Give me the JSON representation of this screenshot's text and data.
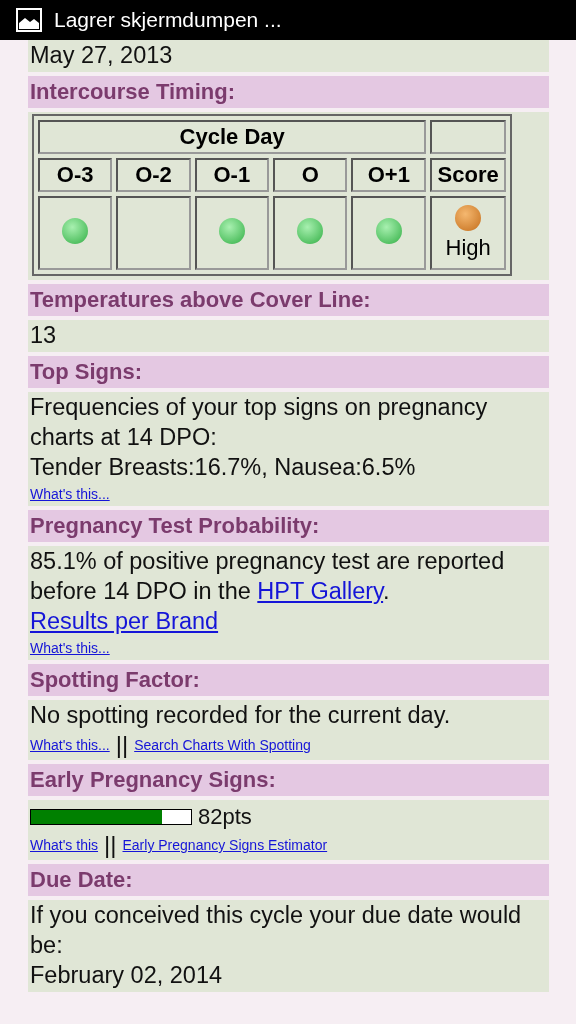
{
  "status_bar": {
    "notification": "Lagrer skjermdumpen ..."
  },
  "sections": [
    {
      "kind": "text",
      "paragraphs": [
        [
          {
            "text": "May 27, 2013",
            "link": false
          }
        ]
      ]
    },
    {
      "kind": "timing",
      "title": "Intercourse Timing:",
      "table": {
        "group_header": "Cycle Day",
        "score_header": "Score",
        "score": "High",
        "days": [
          {
            "label": "O-3",
            "intercourse": true
          },
          {
            "label": "O-2",
            "intercourse": false
          },
          {
            "label": "O-1",
            "intercourse": true
          },
          {
            "label": "O",
            "intercourse": true
          },
          {
            "label": "O+1",
            "intercourse": true
          }
        ]
      }
    },
    {
      "kind": "text",
      "title": "Temperatures above Cover Line:",
      "paragraphs": [
        [
          {
            "text": "13",
            "link": false
          }
        ]
      ]
    },
    {
      "kind": "text",
      "title": "Top Signs:",
      "paragraphs": [
        [
          {
            "text": "Frequencies of your top signs on pregnancy charts at 14 DPO:",
            "link": false
          }
        ],
        [
          {
            "text": "Tender Breasts:16.7%, Nausea:6.5%",
            "link": false
          }
        ]
      ],
      "links": [
        "What's this..."
      ]
    },
    {
      "kind": "text",
      "title": "Pregnancy Test Probability:",
      "paragraphs": [
        [
          {
            "text": "85.1% of positive pregnancy test are reported before 14 DPO in the ",
            "link": false
          },
          {
            "text": "HPT Gallery",
            "link": true
          },
          {
            "text": ". ",
            "link": false
          },
          {
            "text": "Results per Brand",
            "link": true
          }
        ]
      ],
      "links": [
        "What's this..."
      ]
    },
    {
      "kind": "text",
      "title": "Spotting Factor:",
      "paragraphs": [
        [
          {
            "text": "No spotting recorded for the current day.",
            "link": false
          }
        ]
      ],
      "links": [
        "What's this...",
        "Search Charts With Spotting"
      ],
      "separator": "||"
    },
    {
      "kind": "meter",
      "title": "Early Pregnancy Signs:",
      "level": 0.82,
      "reading": "82pts",
      "links": [
        "What's this",
        "Early Pregnancy Signs Estimator"
      ],
      "separator": "||"
    },
    {
      "kind": "text",
      "title": "Due Date:",
      "paragraphs": [
        [
          {
            "text": "If you conceived this cycle your due date would be:",
            "link": false
          }
        ],
        [
          {
            "text": "February 02, 2014",
            "link": false
          }
        ]
      ]
    }
  ]
}
